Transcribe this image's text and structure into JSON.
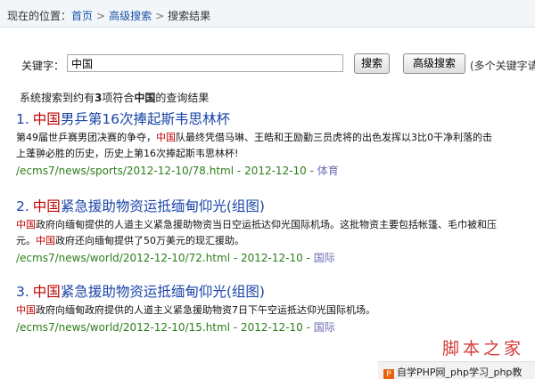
{
  "breadcrumb": {
    "prefix": "现在的位置：",
    "links": [
      "首页",
      "高级搜索"
    ],
    "current": "搜索结果",
    "separator": ">"
  },
  "search": {
    "label": "关键字：",
    "value": "中国",
    "search_button": "搜索",
    "advanced_button": "高级搜索",
    "hint": "(多个关键字请"
  },
  "summary": {
    "text_before": "系统搜索到约有",
    "count": "3",
    "text_middle": "项符合",
    "keyword": "中国",
    "text_after": "的查询结果"
  },
  "results": [
    {
      "index": "1.",
      "title_highlight": "中国",
      "title_rest": "男乒第16次捧起斯韦思林杯",
      "desc_lines": [
        [
          {
            "t": "第49届世乒赛男团决赛的争夺，",
            "hl": false
          },
          {
            "t": "中国",
            "hl": true
          },
          {
            "t": "队最终凭借马琳、王皓和王励勤三员虎将的出色发挥以3比0干净利落的击",
            "hl": false
          }
        ],
        [
          {
            "t": "上蓬翀必胜的历史，历史上第16次捧起斯韦思林杯!",
            "hl": false
          }
        ]
      ],
      "url": "/ecms7/news/sports/2012-12-10/78.html",
      "date": "2012-12-10",
      "category": "体育"
    },
    {
      "index": "2.",
      "title_highlight": "中国",
      "title_rest": "紧急援助物资运抵缅甸仰光(组图)",
      "desc_lines": [
        [
          {
            "t": "中国",
            "hl": true
          },
          {
            "t": "政府向缅甸提供的人道主义紧急援助物资当日空运抵达仰光国际机场。这批物资主要包括帐篷、毛巾被和压",
            "hl": false
          }
        ],
        [
          {
            "t": "元。",
            "hl": false
          },
          {
            "t": "中国",
            "hl": true
          },
          {
            "t": "政府还向缅甸提供了50万美元的现汇援助。",
            "hl": false
          }
        ]
      ],
      "url": "/ecms7/news/world/2012-12-10/72.html",
      "date": "2012-12-10",
      "category": "国际"
    },
    {
      "index": "3.",
      "title_highlight": "中国",
      "title_rest": "紧急援助物资运抵缅甸仰光(组图)",
      "desc_lines": [
        [
          {
            "t": "中国",
            "hl": true
          },
          {
            "t": "政府向缅甸政府提供的人道主义紧急援助物资7日下午空运抵达仰光国际机场。",
            "hl": false
          }
        ]
      ],
      "url": "/ecms7/news/world/2012-12-10/15.html",
      "date": "2012-12-10",
      "category": "国际"
    }
  ],
  "meta_separator": " - ",
  "watermarks": {
    "brand": "脚本之家",
    "footer": "自学PHP网_php学习_php教",
    "footer_logo": "P"
  },
  "colors": {
    "link_blue": "#1a45a8",
    "highlight_red": "#c00000",
    "url_green": "#2d7d1a",
    "category_purple": "#6c6cb4"
  }
}
